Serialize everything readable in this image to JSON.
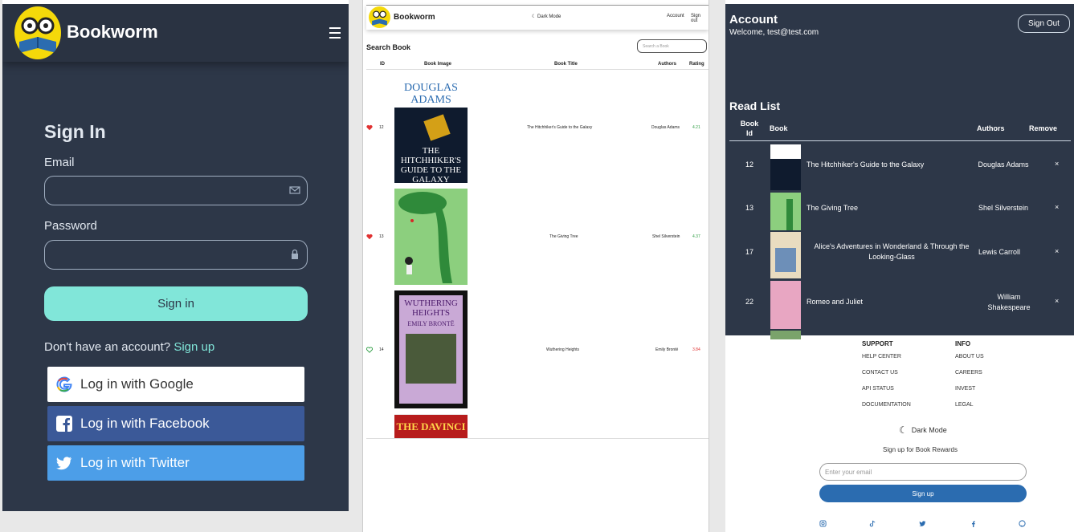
{
  "signin_page": {
    "app_name": "Bookworm",
    "title": "Sign In",
    "email_label": "Email",
    "password_label": "Password",
    "signin_button": "Sign in",
    "no_account_text": "Don't have an account?",
    "signup_link": "Sign up",
    "google_button": "Log in with Google",
    "facebook_button": "Log in with Facebook",
    "twitter_button": "Log in with Twitter"
  },
  "search_page": {
    "app_name": "Bookworm",
    "dark_mode": "Dark Mode",
    "account_link": "Account",
    "signout_link": "Sign out",
    "title": "Search Book",
    "search_placeholder": "Search a Book",
    "columns": [
      "ID",
      "Book Image",
      "Book Title",
      "Authors",
      "Rating"
    ],
    "rows": [
      {
        "id": "12",
        "title": "The Hitchhiker's Guide to the Galaxy",
        "author": "Douglas Adams",
        "rating": "4.21",
        "favorite": true
      },
      {
        "id": "13",
        "title": "The Giving Tree",
        "author": "Shel Silverstein",
        "rating": "4.37",
        "favorite": true
      },
      {
        "id": "14",
        "title": "Wuthering Heights",
        "author": "Emily Brontë",
        "rating": "3.84",
        "favorite": false
      }
    ],
    "cover_texts": {
      "hitchhiker_author": "DOUGLAS ADAMS",
      "hitchhiker_title": "THE HITCHHIKER'S GUIDE TO THE GALAXY",
      "wuthering_title": "WUTHERING HEIGHTS",
      "wuthering_author": "EMILY BRONTË",
      "davinci_partial": "THE DAVINCI"
    }
  },
  "account_page": {
    "title": "Account",
    "welcome": "Welcome, test@test.com",
    "signout_button": "Sign Out",
    "readlist_title": "Read List",
    "columns": {
      "id": "Book Id",
      "book": "Book",
      "authors": "Authors",
      "remove": "Remove"
    },
    "rows": [
      {
        "id": "12",
        "title": "The Hitchhiker's Guide to the Galaxy",
        "author": "Douglas Adams",
        "remove": "×"
      },
      {
        "id": "13",
        "title": "The Giving Tree",
        "author": "Shel Silverstein",
        "remove": "×"
      },
      {
        "id": "17",
        "title": "Alice's Adventures in Wonderland & Through the Looking-Glass",
        "author": "Lewis Carroll",
        "remove": "×"
      },
      {
        "id": "22",
        "title": "Romeo and Juliet",
        "author": "William Shakespeare",
        "remove": "×"
      }
    ],
    "footer": {
      "support_heading": "SUPPORT",
      "support_links": [
        "HELP CENTER",
        "CONTACT US",
        "API STATUS",
        "DOCUMENTATION"
      ],
      "info_heading": "INFO",
      "info_links": [
        "ABOUT US",
        "CAREERS",
        "INVEST",
        "LEGAL"
      ],
      "dark_mode": "Dark Mode",
      "rewards_text": "Sign up for Book Rewards",
      "email_placeholder": "Enter your email",
      "signup_button": "Sign up"
    }
  },
  "colors": {
    "dark_bg": "#2d3748",
    "accent_teal": "#81e6d9",
    "facebook": "#3b5998",
    "twitter": "#4c9ee8",
    "signup_blue": "#2b6cb0",
    "rating_green": "#2f9e44",
    "rating_red": "#e03131",
    "heart_red": "#e03131"
  }
}
